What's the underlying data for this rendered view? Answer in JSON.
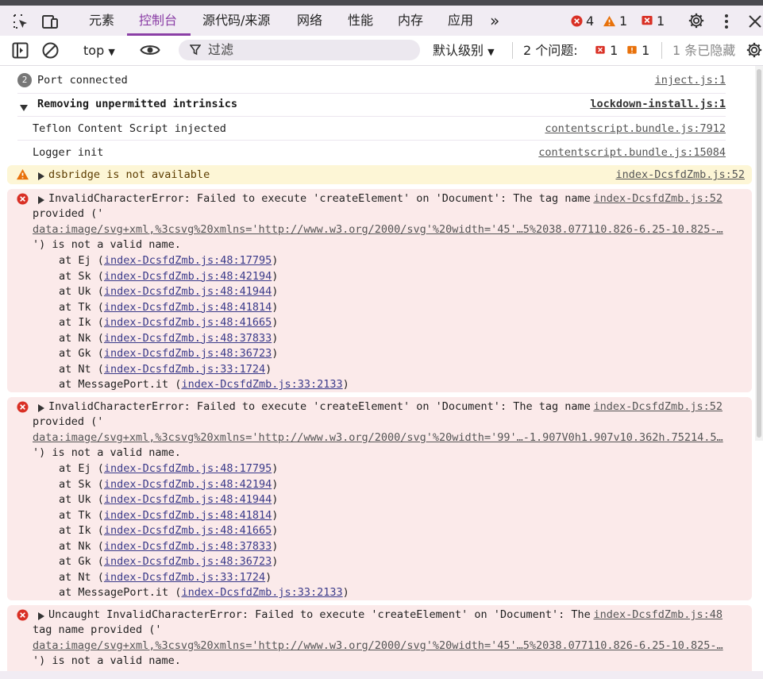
{
  "tabs": [
    "元素",
    "控制台",
    "源代码/来源",
    "网络",
    "性能",
    "内存",
    "应用"
  ],
  "counts": {
    "errors": "4",
    "warnings": "1",
    "issues": "1"
  },
  "toolbar": {
    "context": "top",
    "filter_placeholder": "过滤",
    "level": "默认级别",
    "issues_label": "2 个问题:",
    "issues_errors": "1",
    "issues_warnings": "1",
    "hidden": "1 条已隐藏"
  },
  "colors": {
    "accent": "#8b3fa6",
    "error": "#d93025",
    "warning": "#e8710a"
  },
  "messages": {
    "port": {
      "count": "2",
      "text": "Port connected",
      "src": "inject.js:1"
    },
    "lockdown": {
      "text": "Removing unpermitted intrinsics",
      "src": "lockdown-install.js:1"
    },
    "teflon": {
      "text": "Teflon Content Script injected",
      "src": "contentscript.bundle.js:7912"
    },
    "logger": {
      "text": "Logger init",
      "src": "contentscript.bundle.js:15084"
    },
    "warn": {
      "text": "dsbridge is not available",
      "src": "index-DcsfdZmb.js:52"
    }
  },
  "errors": [
    {
      "line1": "InvalidCharacterError: Failed to execute 'createElement' on 'Document': The tag name",
      "line2": "provided ('",
      "url": "data:image/svg+xml,%3csvg%20xmlns='http://www.w3.org/2000/svg'%20width='45'…5%2038.077110.826-6.25-10.825-…",
      "line4": "') is not a valid name.",
      "src": "index-DcsfdZmb.js:52",
      "stack": [
        {
          "fn": "at Ej (",
          "loc": "index-DcsfdZmb.js:48:17795"
        },
        {
          "fn": "at Sk (",
          "loc": "index-DcsfdZmb.js:48:42194"
        },
        {
          "fn": "at Uk (",
          "loc": "index-DcsfdZmb.js:48:41944"
        },
        {
          "fn": "at Tk (",
          "loc": "index-DcsfdZmb.js:48:41814"
        },
        {
          "fn": "at Ik (",
          "loc": "index-DcsfdZmb.js:48:41665"
        },
        {
          "fn": "at Nk (",
          "loc": "index-DcsfdZmb.js:48:37833"
        },
        {
          "fn": "at Gk (",
          "loc": "index-DcsfdZmb.js:48:36723"
        },
        {
          "fn": "at Nt (",
          "loc": "index-DcsfdZmb.js:33:1724"
        },
        {
          "fn": "at MessagePort.it (",
          "loc": "index-DcsfdZmb.js:33:2133"
        }
      ]
    },
    {
      "line1": "InvalidCharacterError: Failed to execute 'createElement' on 'Document': The tag name",
      "line2": "provided ('",
      "url": "data:image/svg+xml,%3csvg%20xmlns='http://www.w3.org/2000/svg'%20width='99'…-1.907V0h1.907v10.362h.75214.5…",
      "line4": "') is not a valid name.",
      "src": "index-DcsfdZmb.js:52",
      "stack": [
        {
          "fn": "at Ej (",
          "loc": "index-DcsfdZmb.js:48:17795"
        },
        {
          "fn": "at Sk (",
          "loc": "index-DcsfdZmb.js:48:42194"
        },
        {
          "fn": "at Uk (",
          "loc": "index-DcsfdZmb.js:48:41944"
        },
        {
          "fn": "at Tk (",
          "loc": "index-DcsfdZmb.js:48:41814"
        },
        {
          "fn": "at Ik (",
          "loc": "index-DcsfdZmb.js:48:41665"
        },
        {
          "fn": "at Nk (",
          "loc": "index-DcsfdZmb.js:48:37833"
        },
        {
          "fn": "at Gk (",
          "loc": "index-DcsfdZmb.js:48:36723"
        },
        {
          "fn": "at Nt (",
          "loc": "index-DcsfdZmb.js:33:1724"
        },
        {
          "fn": "at MessagePort.it (",
          "loc": "index-DcsfdZmb.js:33:2133"
        }
      ]
    },
    {
      "line1": "Uncaught InvalidCharacterError: Failed to execute 'createElement' on 'Document': The",
      "line2": "tag name provided ('",
      "url": "data:image/svg+xml,%3csvg%20xmlns='http://www.w3.org/2000/svg'%20width='45'…5%2038.077110.826-6.25-10.825-…",
      "line4": "') is not a valid name.",
      "src": "index-DcsfdZmb.js:48",
      "stack": []
    }
  ]
}
